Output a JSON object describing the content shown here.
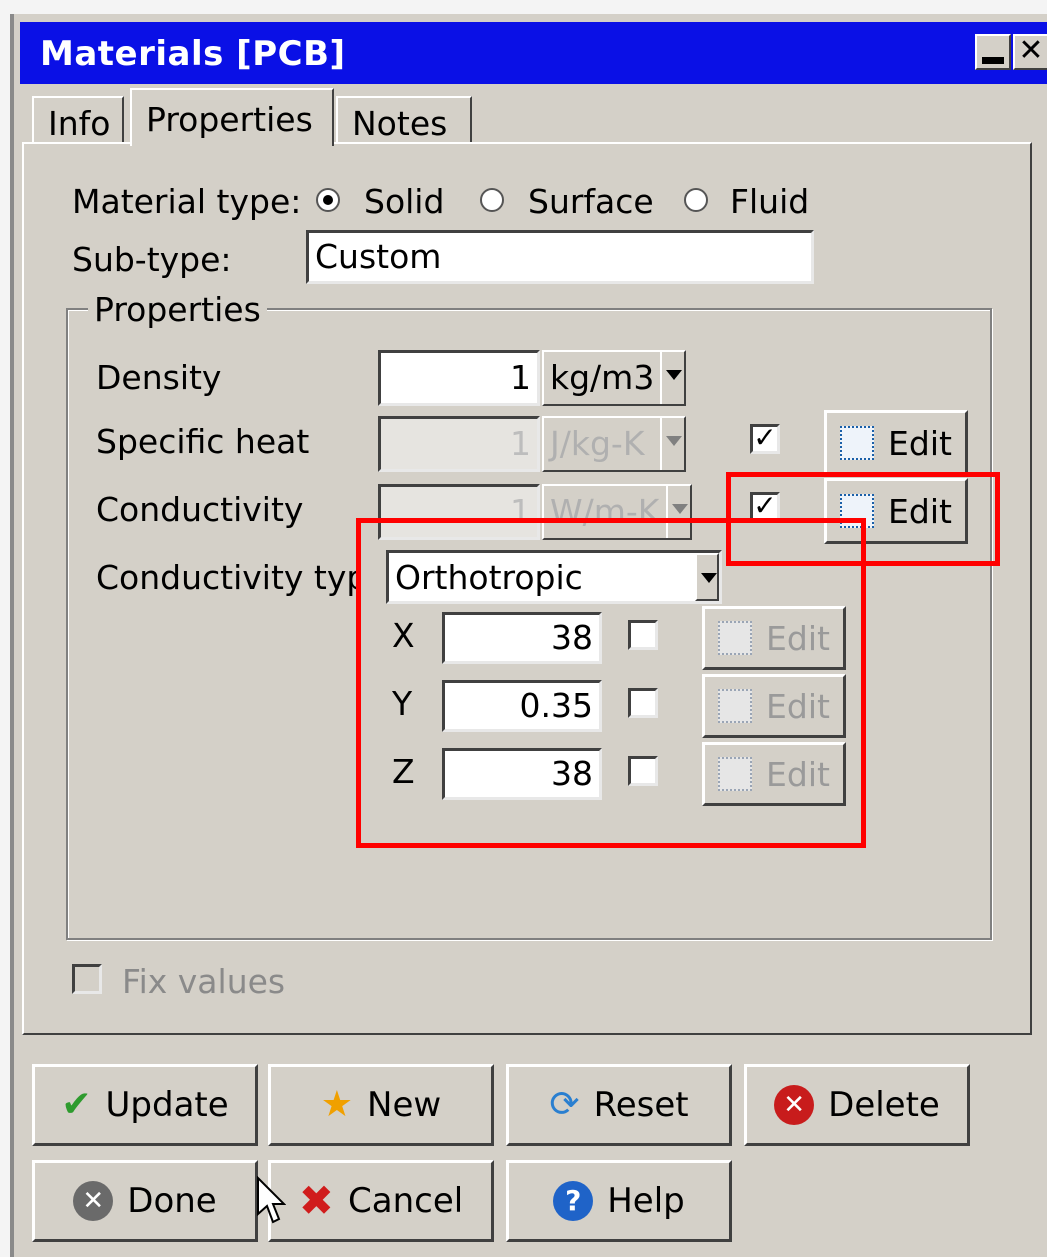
{
  "window": {
    "title": "Materials [PCB]"
  },
  "tabs": [
    {
      "label": "Info"
    },
    {
      "label": "Properties"
    },
    {
      "label": "Notes"
    }
  ],
  "material_type": {
    "label": "Material type:",
    "options": [
      "Solid",
      "Surface",
      "Fluid"
    ],
    "selected": "Solid"
  },
  "subtype": {
    "label": "Sub-type:",
    "value": "Custom"
  },
  "properties_group": {
    "title": "Properties",
    "density": {
      "label": "Density",
      "value": "1",
      "unit": "kg/m3"
    },
    "specific_heat": {
      "label": "Specific heat",
      "value": "1",
      "unit": "J/kg-K",
      "checked": true,
      "edit": "Edit"
    },
    "conductivity": {
      "label": "Conductivity",
      "value": "1",
      "unit": "W/m-K",
      "checked": true,
      "edit": "Edit"
    },
    "conductivity_type": {
      "label": "Conductivity type",
      "value": "Orthotropic"
    },
    "axes": [
      {
        "axis": "X",
        "value": "38",
        "checked": false,
        "edit": "Edit"
      },
      {
        "axis": "Y",
        "value": "0.35",
        "checked": false,
        "edit": "Edit"
      },
      {
        "axis": "Z",
        "value": "38",
        "checked": false,
        "edit": "Edit"
      }
    ]
  },
  "fix_values": {
    "label": "Fix values",
    "checked": false
  },
  "buttons": {
    "update": "Update",
    "new": "New",
    "reset": "Reset",
    "delete": "Delete",
    "done": "Done",
    "cancel": "Cancel",
    "help": "Help"
  },
  "colors": {
    "titlebar": "#0a10e6",
    "highlight": "#ff0000",
    "face": "#d4d0c8"
  }
}
